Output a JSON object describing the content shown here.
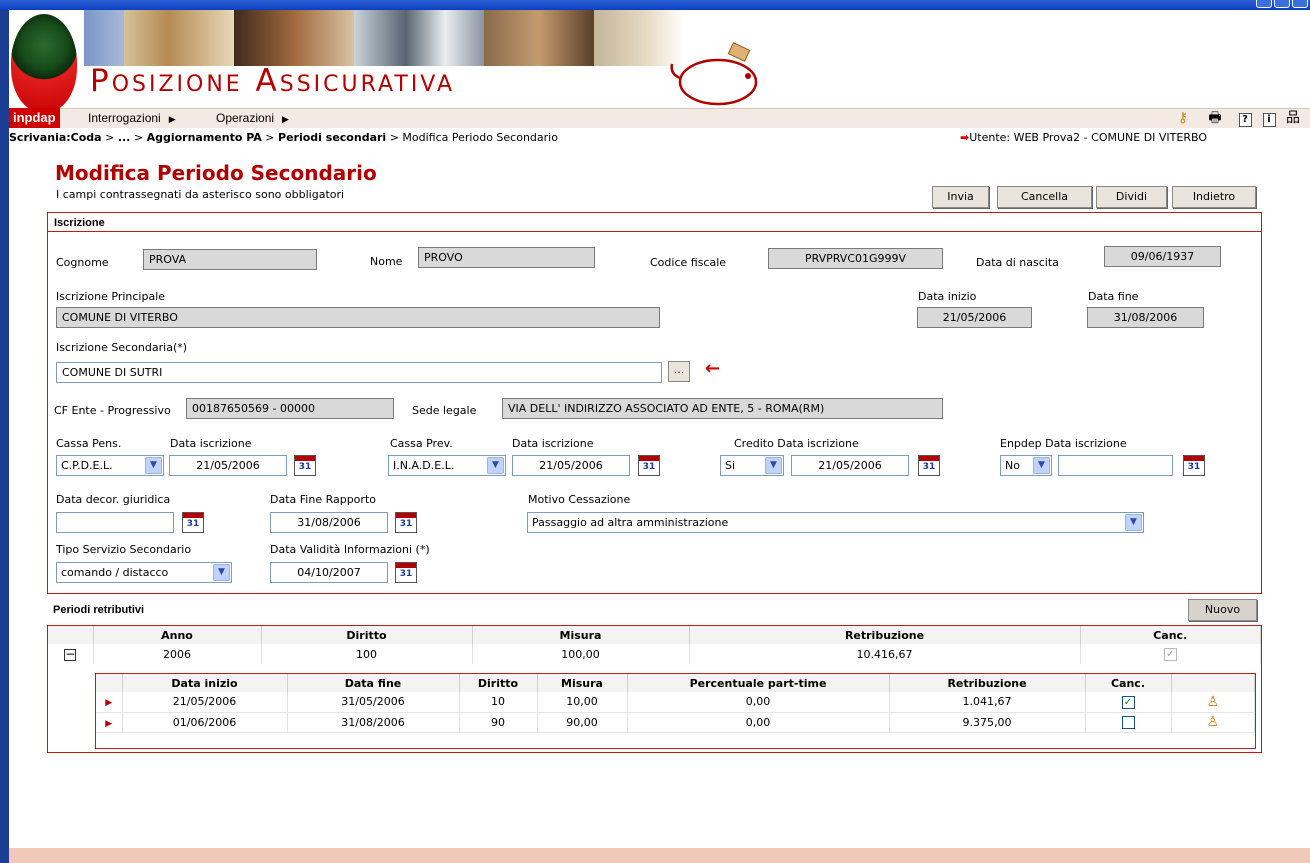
{
  "header": {
    "app_title": "Posizione Assicurativa",
    "logo_text": "inpdap"
  },
  "menu": {
    "items": [
      {
        "label": "Interrogazioni"
      },
      {
        "label": "Operazioni"
      }
    ],
    "toolbar_icons": [
      "key-icon",
      "print-icon",
      "help-icon",
      "info-icon",
      "sitemap-icon"
    ]
  },
  "breadcrumb": {
    "part1": "Scrivania:Coda",
    "sep1": " > ",
    "part2": "...",
    "sep2": " > ",
    "part3": "Aggiornamento PA",
    "sep3": " > ",
    "part4": "Periodi secondari",
    "sep4": " > ",
    "current": "Modifica Periodo Secondario"
  },
  "user_info": "Utente: WEB Prova2 - COMUNE DI VITERBO",
  "page": {
    "title": "Modifica Periodo Secondario",
    "subtitle": "I campi contrassegnati da asterisco sono obbligatori"
  },
  "actions": {
    "invia": "Invia",
    "cancella": "Cancella",
    "dividi": "Dividi",
    "indietro": "Indietro"
  },
  "iscrizione": {
    "section_title": "Iscrizione",
    "cognome_label": "Cognome",
    "cognome": "PROVA",
    "nome_label": "Nome",
    "nome": "PROVO",
    "cf_label": "Codice fiscale",
    "cf": "PRVPRVC01G999V",
    "nascita_label": "Data di nascita",
    "nascita": "09/06/1937",
    "principale_label": "Iscrizione Principale",
    "principale": "COMUNE DI VITERBO",
    "data_inizio_label": "Data inizio",
    "data_inizio": "21/05/2006",
    "data_fine_label": "Data fine",
    "data_fine": "31/08/2006",
    "secondaria_label": "Iscrizione Secondaria(*)",
    "secondaria": "COMUNE DI SUTRI",
    "browse_label": "...",
    "cf_ente_label": "CF Ente - Progressivo",
    "cf_ente": "00187650569 - 00000",
    "sede_label": "Sede legale",
    "sede": "VIA DELL' INDIRIZZO ASSOCIATO AD ENTE, 5 - ROMA(RM)",
    "cassa_pens_label": "Cassa Pens.",
    "cassa_pens": "C.P.D.E.L.",
    "cassa_pens_data_label": "Data iscrizione",
    "cassa_pens_data": "21/05/2006",
    "cassa_prev_label": "Cassa Prev.",
    "cassa_prev": "I.N.A.D.E.L.",
    "cassa_prev_data_label": "Data iscrizione",
    "cassa_prev_data": "21/05/2006",
    "credito_label": "Credito Data iscrizione",
    "credito": "Si",
    "credito_data": "21/05/2006",
    "enpdep_label": "Enpdep Data iscrizione",
    "enpdep": "No",
    "enpdep_data": "",
    "decor_label": "Data decor. giuridica",
    "decor": "",
    "fine_rapporto_label": "Data Fine Rapporto",
    "fine_rapporto": "31/08/2006",
    "motivo_label": "Motivo Cessazione",
    "motivo": "Passaggio ad altra amministrazione",
    "tipo_servizio_label": "Tipo Servizio Secondario",
    "tipo_servizio": "comando / distacco",
    "validita_label": "Data Validità Informazioni (*)",
    "validita": "04/10/2007",
    "calendar_label": "31"
  },
  "periodi": {
    "section_title": "Periodi retributivi",
    "nuovo_label": "Nuovo",
    "headers": [
      "Anno",
      "Diritto",
      "Misura",
      "Retribuzione",
      "Canc."
    ],
    "year_row": {
      "anno": "2006",
      "diritto": "100",
      "misura": "100,00",
      "retribuzione": "10.416,67",
      "canc": true
    },
    "expand_symbol": "−",
    "sub_headers": [
      "Data inizio",
      "Data fine",
      "Diritto",
      "Misura",
      "Percentuale part-time",
      "Retribuzione",
      "Canc."
    ],
    "rows": [
      {
        "data_inizio": "21/05/2006",
        "data_fine": "31/05/2006",
        "diritto": "10",
        "misura": "10,00",
        "parttime": "0,00",
        "retribuzione": "1.041,67",
        "canc": true
      },
      {
        "data_inizio": "01/06/2006",
        "data_fine": "31/08/2006",
        "diritto": "90",
        "misura": "90,00",
        "parttime": "0,00",
        "retribuzione": "9.375,00",
        "canc": false
      }
    ]
  },
  "colors": {
    "accent": "#b00000",
    "border": "#c21a1a",
    "menu_bg": "#f3ebe3"
  }
}
